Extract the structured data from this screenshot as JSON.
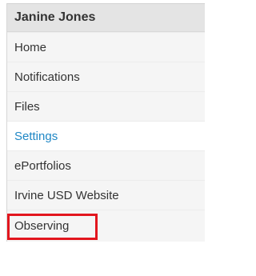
{
  "user": {
    "name": "Janine Jones"
  },
  "menu": {
    "items": [
      {
        "label": "Home"
      },
      {
        "label": "Notifications"
      },
      {
        "label": "Files"
      },
      {
        "label": "Settings"
      },
      {
        "label": "ePortfolios"
      },
      {
        "label": "Irvine USD Website"
      },
      {
        "label": "Observing"
      }
    ]
  },
  "colors": {
    "active_link": "#1f87c5",
    "highlight_border": "#e2161e",
    "header_background": "#e4e4e4",
    "menu_background": "#f5f5f5"
  }
}
